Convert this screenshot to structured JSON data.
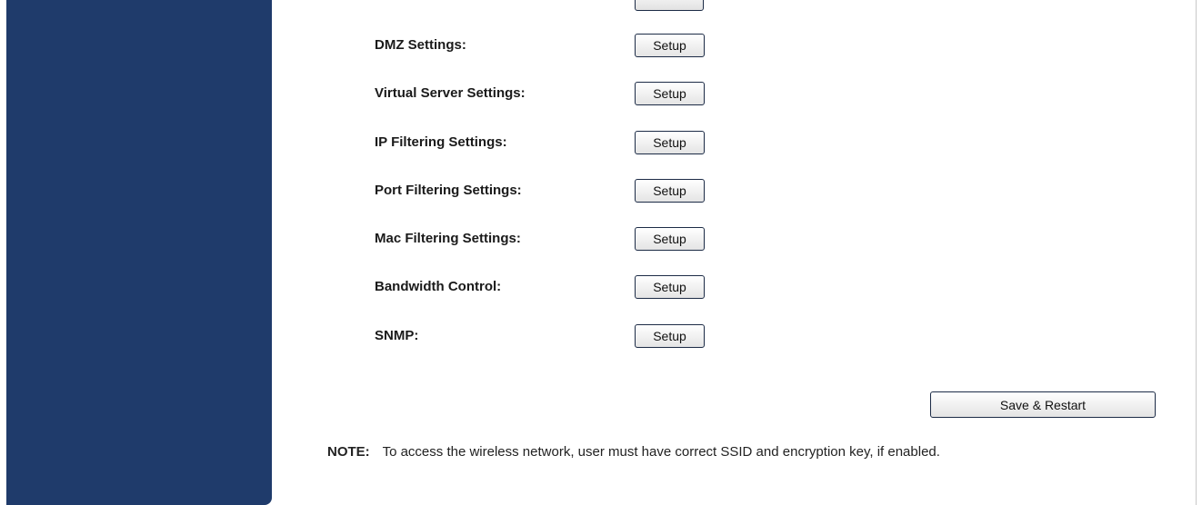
{
  "settings": {
    "rows": [
      {
        "label": "DMZ Settings:",
        "button": "Setup"
      },
      {
        "label": "Virtual Server Settings:",
        "button": "Setup"
      },
      {
        "label": "IP Filtering Settings:",
        "button": "Setup"
      },
      {
        "label": "Port Filtering Settings:",
        "button": "Setup"
      },
      {
        "label": "Mac Filtering Settings:",
        "button": "Setup"
      },
      {
        "label": "Bandwidth Control:",
        "button": "Setup"
      },
      {
        "label": "SNMP:",
        "button": "Setup"
      }
    ]
  },
  "actions": {
    "save_restart": "Save & Restart"
  },
  "note": {
    "label": "NOTE:",
    "text": "To access the wireless network, user must have correct SSID and encryption key, if enabled."
  },
  "colors": {
    "sidebar": "#1f3b6b",
    "button_border": "#1c2b46"
  }
}
